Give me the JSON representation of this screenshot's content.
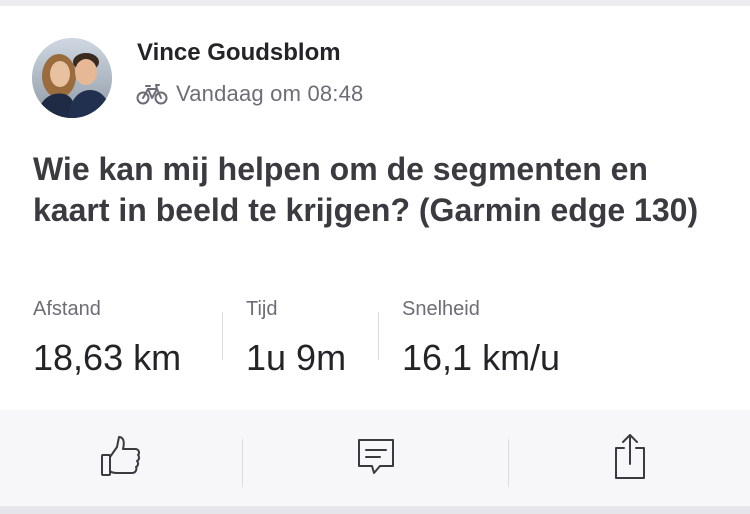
{
  "post": {
    "athlete_name": "Vince Goudsblom",
    "activity_type_icon": "bike-icon",
    "timestamp": "Vandaag om 08:48",
    "title": "Wie kan mij helpen om de segmenten en kaart in beeld te krijgen? (Garmin edge 130)"
  },
  "stats": [
    {
      "label": "Afstand",
      "value": "18,63 km"
    },
    {
      "label": "Tijd",
      "value": "1u 9m"
    },
    {
      "label": "Snelheid",
      "value": "16,1 km/u"
    }
  ],
  "actions": [
    {
      "icon": "thumbs-up-icon"
    },
    {
      "icon": "comment-icon"
    },
    {
      "icon": "share-icon"
    }
  ],
  "colors": {
    "text_primary": "#242428",
    "text_secondary": "#6d6d78",
    "action_bar_bg": "#f7f7fa",
    "divider": "#dcdce0"
  }
}
